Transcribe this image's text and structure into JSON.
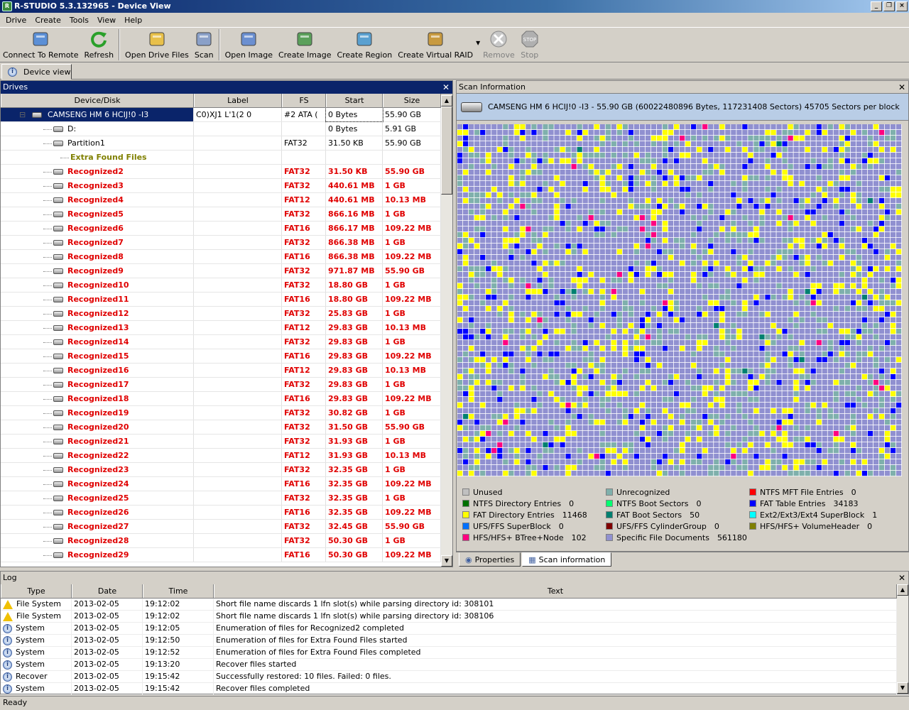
{
  "window": {
    "title": "R-STUDIO 5.3.132965 - Device View",
    "icon_label": "R"
  },
  "menu": [
    "Drive",
    "Create",
    "Tools",
    "View",
    "Help"
  ],
  "toolbar": [
    {
      "label": "Connect To Remote",
      "icon": "connect-remote-icon",
      "enabled": true
    },
    {
      "label": "Refresh",
      "icon": "refresh-icon",
      "enabled": true
    },
    {
      "label": "Open Drive Files",
      "icon": "open-drive-files-icon",
      "enabled": true
    },
    {
      "label": "Scan",
      "icon": "scan-icon",
      "enabled": true
    },
    {
      "label": "Open Image",
      "icon": "open-image-icon",
      "enabled": true
    },
    {
      "label": "Create Image",
      "icon": "create-image-icon",
      "enabled": true
    },
    {
      "label": "Create Region",
      "icon": "create-region-icon",
      "enabled": true
    },
    {
      "label": "Create Virtual RAID",
      "icon": "create-raid-icon",
      "enabled": true
    },
    {
      "label": "Remove",
      "icon": "remove-icon",
      "enabled": false
    },
    {
      "label": "Stop",
      "icon": "stop-icon",
      "enabled": false
    }
  ],
  "view_tab": "Device view",
  "drives": {
    "title": "Drives",
    "columns": [
      "Device/Disk",
      "Label",
      "FS",
      "Start",
      "Size"
    ],
    "rows": [
      {
        "name": "CAMSENG HM 6 HCIJ!0 -I3",
        "label": "C0)XJ1 L'1(2 0",
        "fs": "#2 ATA (",
        "start": "0 Bytes",
        "size": "55.90 GB",
        "style": "sel",
        "level": 0
      },
      {
        "name": "D:",
        "label": "",
        "fs": "",
        "start": "0 Bytes",
        "size": "5.91 GB",
        "style": "",
        "level": 1
      },
      {
        "name": "Partition1",
        "label": "",
        "fs": "FAT32",
        "start": "31.50 KB",
        "size": "55.90 GB",
        "style": "",
        "level": 1
      },
      {
        "name": "Extra Found Files",
        "label": "",
        "fs": "",
        "start": "",
        "size": "",
        "style": "olive",
        "level": 1
      },
      {
        "name": "Recognized2",
        "label": "",
        "fs": "FAT32",
        "start": "31.50 KB",
        "size": "55.90 GB",
        "style": "red",
        "level": 1
      },
      {
        "name": "Recognized3",
        "label": "",
        "fs": "FAT32",
        "start": "440.61 MB",
        "size": "1 GB",
        "style": "red",
        "level": 1
      },
      {
        "name": "Recognized4",
        "label": "",
        "fs": "FAT12",
        "start": "440.61 MB",
        "size": "10.13 MB",
        "style": "red",
        "level": 1
      },
      {
        "name": "Recognized5",
        "label": "",
        "fs": "FAT32",
        "start": "866.16 MB",
        "size": "1 GB",
        "style": "red",
        "level": 1
      },
      {
        "name": "Recognized6",
        "label": "",
        "fs": "FAT16",
        "start": "866.17 MB",
        "size": "109.22 MB",
        "style": "red",
        "level": 1
      },
      {
        "name": "Recognized7",
        "label": "",
        "fs": "FAT32",
        "start": "866.38 MB",
        "size": "1 GB",
        "style": "red",
        "level": 1
      },
      {
        "name": "Recognized8",
        "label": "",
        "fs": "FAT16",
        "start": "866.38 MB",
        "size": "109.22 MB",
        "style": "red",
        "level": 1
      },
      {
        "name": "Recognized9",
        "label": "",
        "fs": "FAT32",
        "start": "971.87 MB",
        "size": "55.90 GB",
        "style": "red",
        "level": 1
      },
      {
        "name": "Recognized10",
        "label": "",
        "fs": "FAT32",
        "start": "18.80 GB",
        "size": "1 GB",
        "style": "red",
        "level": 1
      },
      {
        "name": "Recognized11",
        "label": "",
        "fs": "FAT16",
        "start": "18.80 GB",
        "size": "109.22 MB",
        "style": "red",
        "level": 1
      },
      {
        "name": "Recognized12",
        "label": "",
        "fs": "FAT32",
        "start": "25.83 GB",
        "size": "1 GB",
        "style": "red",
        "level": 1
      },
      {
        "name": "Recognized13",
        "label": "",
        "fs": "FAT12",
        "start": "29.83 GB",
        "size": "10.13 MB",
        "style": "red",
        "level": 1
      },
      {
        "name": "Recognized14",
        "label": "",
        "fs": "FAT32",
        "start": "29.83 GB",
        "size": "1 GB",
        "style": "red",
        "level": 1
      },
      {
        "name": "Recognized15",
        "label": "",
        "fs": "FAT16",
        "start": "29.83 GB",
        "size": "109.22 MB",
        "style": "red",
        "level": 1
      },
      {
        "name": "Recognized16",
        "label": "",
        "fs": "FAT12",
        "start": "29.83 GB",
        "size": "10.13 MB",
        "style": "red",
        "level": 1
      },
      {
        "name": "Recognized17",
        "label": "",
        "fs": "FAT32",
        "start": "29.83 GB",
        "size": "1 GB",
        "style": "red",
        "level": 1
      },
      {
        "name": "Recognized18",
        "label": "",
        "fs": "FAT16",
        "start": "29.83 GB",
        "size": "109.22 MB",
        "style": "red",
        "level": 1
      },
      {
        "name": "Recognized19",
        "label": "",
        "fs": "FAT32",
        "start": "30.82 GB",
        "size": "1 GB",
        "style": "red",
        "level": 1
      },
      {
        "name": "Recognized20",
        "label": "",
        "fs": "FAT32",
        "start": "31.50 GB",
        "size": "55.90 GB",
        "style": "red",
        "level": 1
      },
      {
        "name": "Recognized21",
        "label": "",
        "fs": "FAT32",
        "start": "31.93 GB",
        "size": "1 GB",
        "style": "red",
        "level": 1
      },
      {
        "name": "Recognized22",
        "label": "",
        "fs": "FAT12",
        "start": "31.93 GB",
        "size": "10.13 MB",
        "style": "red",
        "level": 1
      },
      {
        "name": "Recognized23",
        "label": "",
        "fs": "FAT32",
        "start": "32.35 GB",
        "size": "1 GB",
        "style": "red",
        "level": 1
      },
      {
        "name": "Recognized24",
        "label": "",
        "fs": "FAT16",
        "start": "32.35 GB",
        "size": "109.22 MB",
        "style": "red",
        "level": 1
      },
      {
        "name": "Recognized25",
        "label": "",
        "fs": "FAT32",
        "start": "32.35 GB",
        "size": "1 GB",
        "style": "red",
        "level": 1
      },
      {
        "name": "Recognized26",
        "label": "",
        "fs": "FAT16",
        "start": "32.35 GB",
        "size": "109.22 MB",
        "style": "red",
        "level": 1
      },
      {
        "name": "Recognized27",
        "label": "",
        "fs": "FAT32",
        "start": "32.45 GB",
        "size": "55.90 GB",
        "style": "red",
        "level": 1
      },
      {
        "name": "Recognized28",
        "label": "",
        "fs": "FAT32",
        "start": "50.30 GB",
        "size": "1 GB",
        "style": "red",
        "level": 1
      },
      {
        "name": "Recognized29",
        "label": "",
        "fs": "FAT16",
        "start": "50.30 GB",
        "size": "109.22 MB",
        "style": "red",
        "level": 1
      }
    ]
  },
  "scan": {
    "title": "Scan Information",
    "disk_summary": "CAMSENG HM 6 HCIJ!0 -I3 - 55.90 GB (60022480896 Bytes, 117231408 Sectors) 45705 Sectors per block",
    "legend": [
      {
        "label": "Unused",
        "value": "",
        "color": "#c0c0c0"
      },
      {
        "label": "Unrecognized",
        "value": "",
        "color": "#7fb0ac"
      },
      {
        "label": "NTFS MFT File Entries",
        "value": "0",
        "color": "#ff0000"
      },
      {
        "label": "NTFS Directory Entries",
        "value": "0",
        "color": "#007000"
      },
      {
        "label": "NTFS Boot Sectors",
        "value": "0",
        "color": "#00ff70"
      },
      {
        "label": "FAT Table Entries",
        "value": "34183",
        "color": "#0000ff"
      },
      {
        "label": "FAT Directory Entries",
        "value": "11468",
        "color": "#ffff00"
      },
      {
        "label": "FAT Boot Sectors",
        "value": "50",
        "color": "#008070"
      },
      {
        "label": "Ext2/Ext3/Ext4 SuperBlock",
        "value": "1",
        "color": "#00ffff"
      },
      {
        "label": "UFS/FFS SuperBlock",
        "value": "0",
        "color": "#0070ff"
      },
      {
        "label": "UFS/FFS CylinderGroup",
        "value": "0",
        "color": "#800000"
      },
      {
        "label": "HFS/HFS+ VolumeHeader",
        "value": "0",
        "color": "#808000"
      },
      {
        "label": "HFS/HFS+ BTree+Node",
        "value": "102",
        "color": "#ff0080"
      },
      {
        "label": "Specific File Documents",
        "value": "561180",
        "color": "#9090d0"
      }
    ],
    "tabs": [
      {
        "label": "Properties",
        "active": false
      },
      {
        "label": "Scan information",
        "active": true
      }
    ]
  },
  "log": {
    "title": "Log",
    "columns": [
      "Type",
      "Date",
      "Time",
      "Text"
    ],
    "rows": [
      {
        "icon": "warning",
        "type": "File System",
        "date": "2013-02-05",
        "time": "19:12:02",
        "text": "Short file name discards 1 lfn slot(s) while parsing directory id: 308101"
      },
      {
        "icon": "warning",
        "type": "File System",
        "date": "2013-02-05",
        "time": "19:12:02",
        "text": "Short file name discards 1 lfn slot(s) while parsing directory id: 308106"
      },
      {
        "icon": "info",
        "type": "System",
        "date": "2013-02-05",
        "time": "19:12:05",
        "text": "Enumeration of files for Recognized2 completed"
      },
      {
        "icon": "info",
        "type": "System",
        "date": "2013-02-05",
        "time": "19:12:50",
        "text": "Enumeration of files for Extra Found Files started"
      },
      {
        "icon": "info",
        "type": "System",
        "date": "2013-02-05",
        "time": "19:12:52",
        "text": "Enumeration of files for Extra Found Files completed"
      },
      {
        "icon": "info",
        "type": "System",
        "date": "2013-02-05",
        "time": "19:13:20",
        "text": "Recover files started"
      },
      {
        "icon": "info",
        "type": "Recover",
        "date": "2013-02-05",
        "time": "19:15:42",
        "text": "Successfully restored: 10 files. Failed: 0 files."
      },
      {
        "icon": "info",
        "type": "System",
        "date": "2013-02-05",
        "time": "19:15:42",
        "text": "Recover files completed"
      }
    ]
  },
  "status": "Ready"
}
